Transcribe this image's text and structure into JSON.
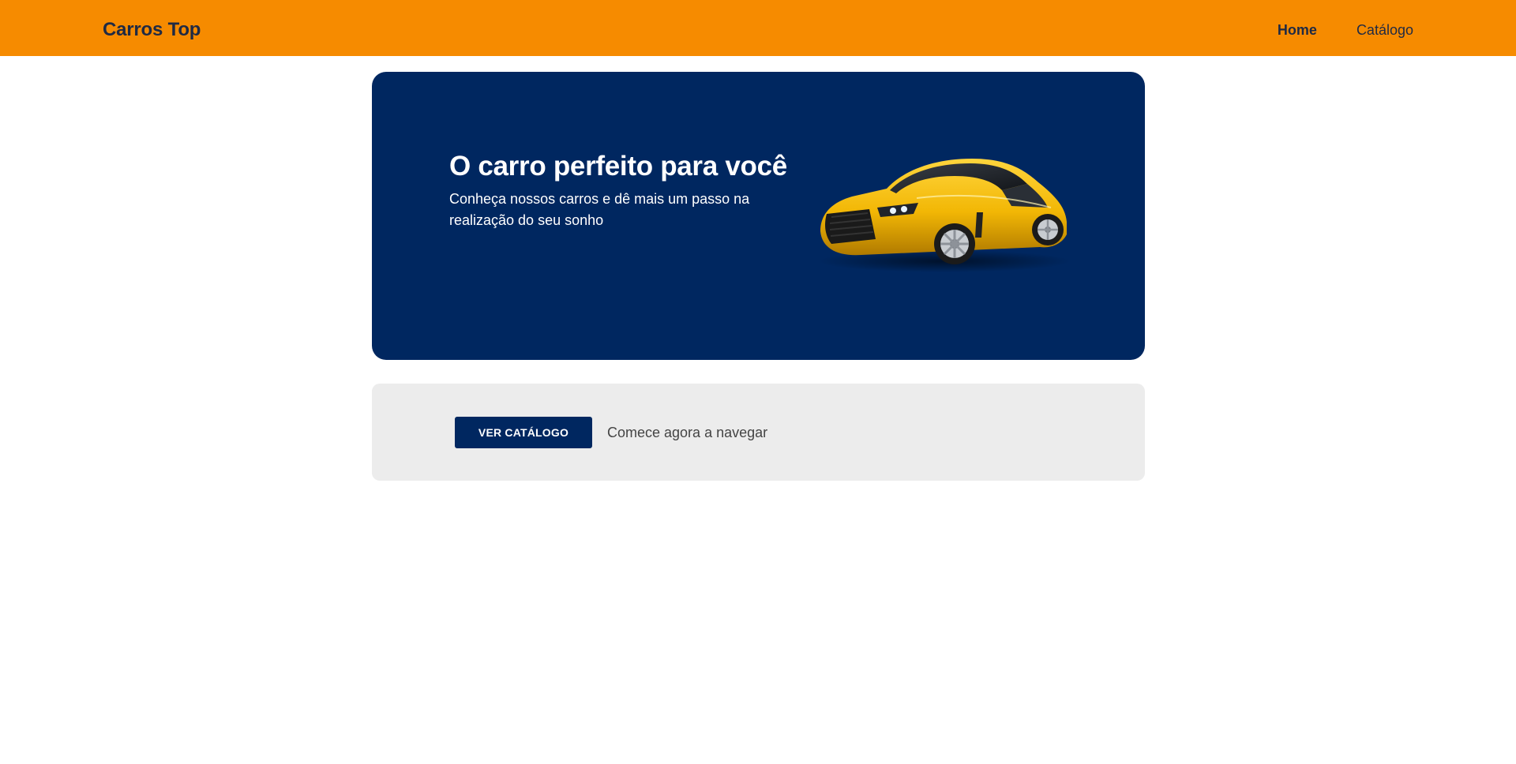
{
  "navbar": {
    "brand": "Carros Top",
    "links": [
      {
        "label": "Home",
        "active": true
      },
      {
        "label": "Catálogo",
        "active": false
      }
    ]
  },
  "hero": {
    "title": "O carro perfeito para você",
    "subtitle": "Conheça nossos carros e dê mais um passo na realização do seu sonho",
    "image": "yellow-sports-car"
  },
  "cta": {
    "button_label": "VER CATÁLOGO",
    "text": "Comece agora a navegar"
  },
  "colors": {
    "navbar_bg": "#f68b00",
    "hero_bg": "#002760",
    "cta_bg": "#ececec",
    "button_bg": "#002760",
    "brand_text": "#1f2a44",
    "car_body": "#f2b705"
  }
}
